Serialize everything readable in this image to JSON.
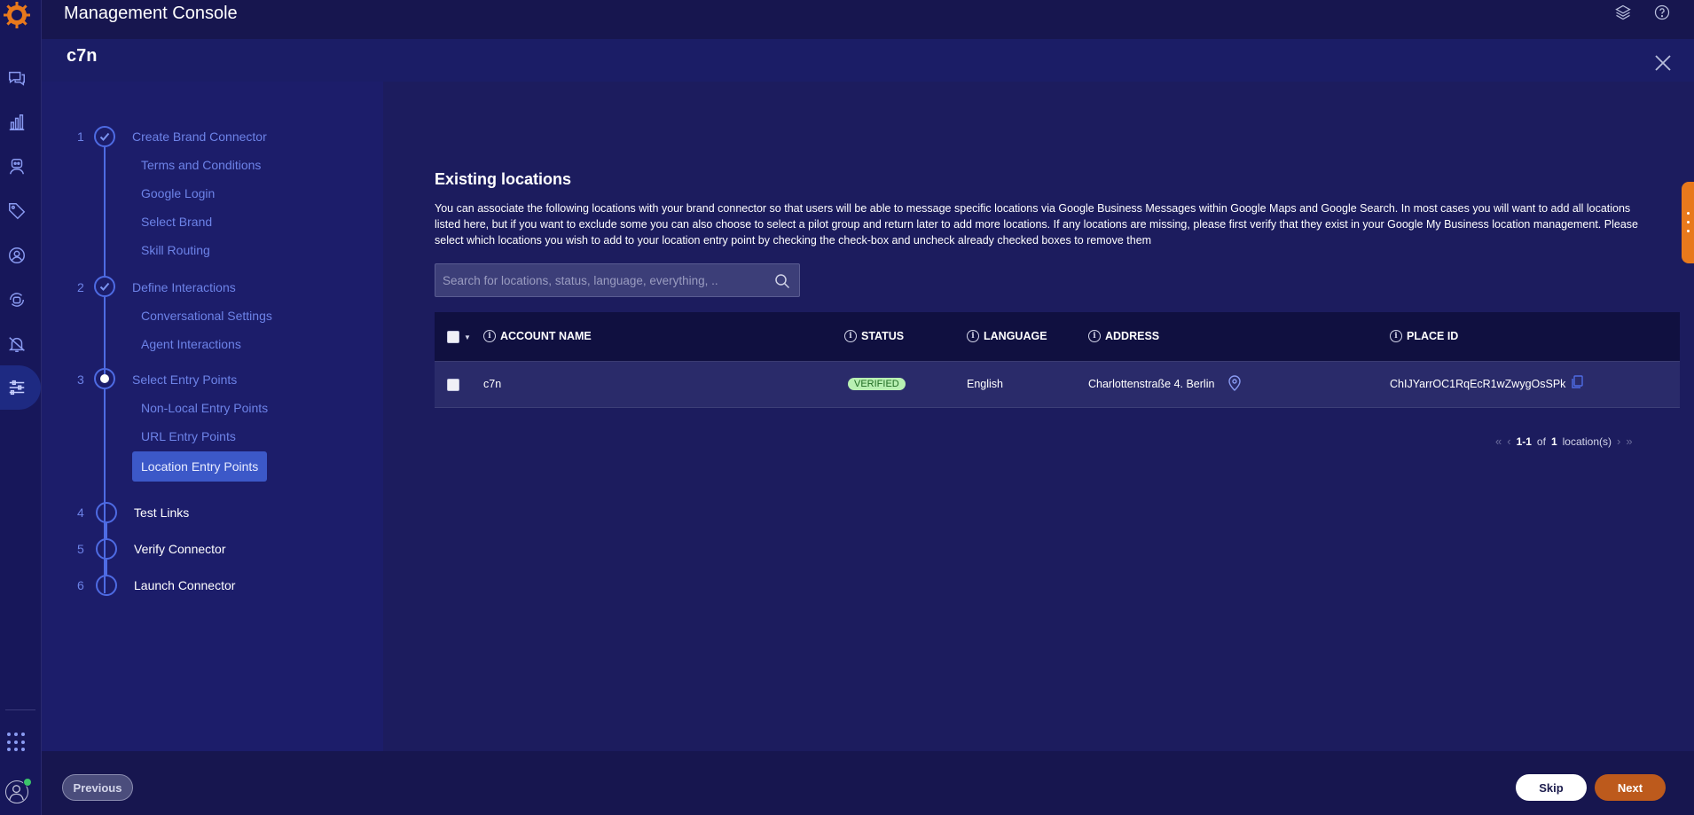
{
  "app": {
    "title": "Management Console"
  },
  "header": {
    "name": "c7n"
  },
  "stepper": {
    "steps": [
      {
        "num": "1",
        "label": "Create Brand Connector",
        "state": "done",
        "subs": [
          "Terms and Conditions",
          "Google Login",
          "Select Brand",
          "Skill Routing"
        ]
      },
      {
        "num": "2",
        "label": "Define Interactions",
        "state": "done",
        "subs": [
          "Conversational Settings",
          "Agent Interactions"
        ]
      },
      {
        "num": "3",
        "label": "Select Entry Points",
        "state": "current",
        "subs": [
          "Non-Local Entry Points",
          "URL Entry Points",
          "Location Entry Points"
        ]
      },
      {
        "num": "4",
        "label": "Test Links",
        "state": "pending"
      },
      {
        "num": "5",
        "label": "Verify Connector",
        "state": "pending"
      },
      {
        "num": "6",
        "label": "Launch Connector",
        "state": "pending"
      }
    ]
  },
  "main": {
    "title": "Existing locations",
    "description": "You can associate the following locations with your brand connector so that users will be able to message specific locations via Google Business Messages within Google Maps and Google Search. In most cases you will want to add all locations listed here, but if you want to exclude some you can also choose to select a pilot group and return later to add more locations. If any locations are missing, please first verify that they exist in your Google My Business location management. Please select which locations you wish to add to your location entry point by checking the check-box and uncheck already checked boxes to remove them",
    "search_placeholder": "Search for locations, status, language, everything, ..",
    "table": {
      "columns": [
        "ACCOUNT NAME",
        "STATUS",
        "LANGUAGE",
        "ADDRESS",
        "PLACE ID"
      ],
      "rows": [
        {
          "account": "c7n",
          "status": "VERIFIED",
          "language": "English",
          "address": "Charlottenstraße 4. Berlin",
          "place_id": "ChIJYarrOC1RqEcR1wZwygOsSPk"
        }
      ]
    },
    "pager": {
      "range": "1-1",
      "of": "of",
      "total": "1",
      "unit": "location(s)"
    }
  },
  "footer": {
    "previous": "Previous",
    "skip": "Skip",
    "next": "Next"
  },
  "colors": {
    "accent": "#4e6be3",
    "next_button": "#bd5a1c",
    "verified_badge": "#b8f0b2",
    "side_tab": "#e8791c"
  }
}
